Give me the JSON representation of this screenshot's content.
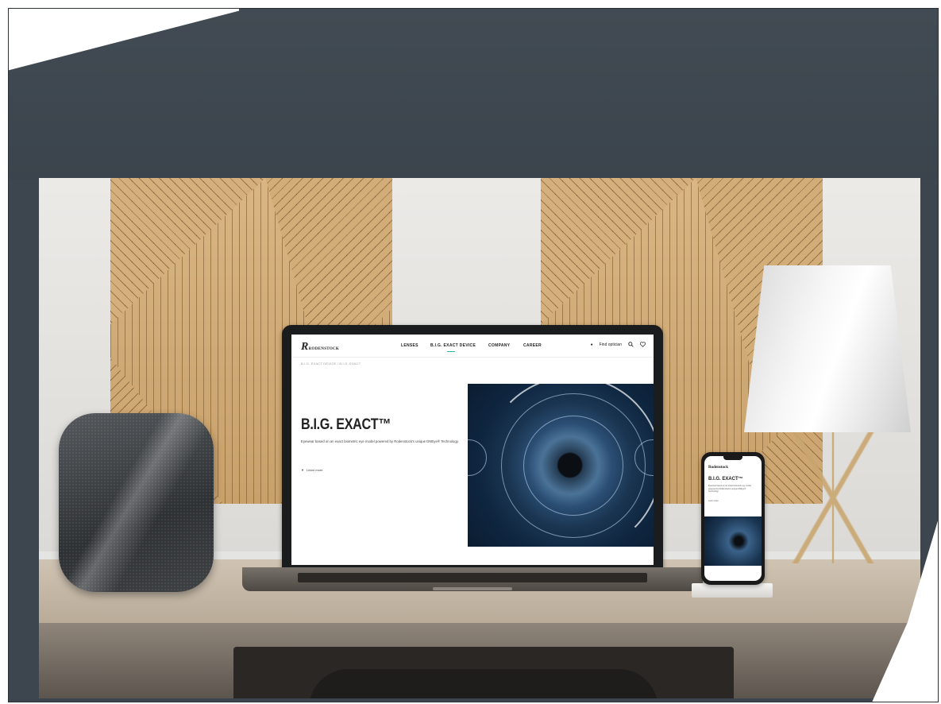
{
  "site": {
    "logo": "RODENSTOCK",
    "nav": [
      "LENSES",
      "B.I.G. EXACT DEVICE",
      "COMPANY",
      "CAREER"
    ],
    "nav_right": "Find optician",
    "breadcrumb": "B.I.G. EXACT DEVICE  /  B.I.G. EXACT",
    "hero_title": "B.I.G. EXACT™",
    "hero_description": "Eyewear based on an exact biometric eye model powered by Rodenstock's unique DNEye® Technology.",
    "hero_link": "Learn more"
  },
  "phone": {
    "logo": "Rodenstock",
    "title": "B.I.G. EXACT™",
    "description": "Eyewear based on an exact biometric eye model powered by Rodenstock's unique DNEye® Technology.",
    "link": "Learn more"
  },
  "colors": {
    "background_wall": "#3d464e",
    "accent": "#26b2a8",
    "wood": "#d2ad78"
  },
  "icons": {
    "search": "search-icon",
    "heart": "heart-icon",
    "location": "location-pin-icon"
  }
}
